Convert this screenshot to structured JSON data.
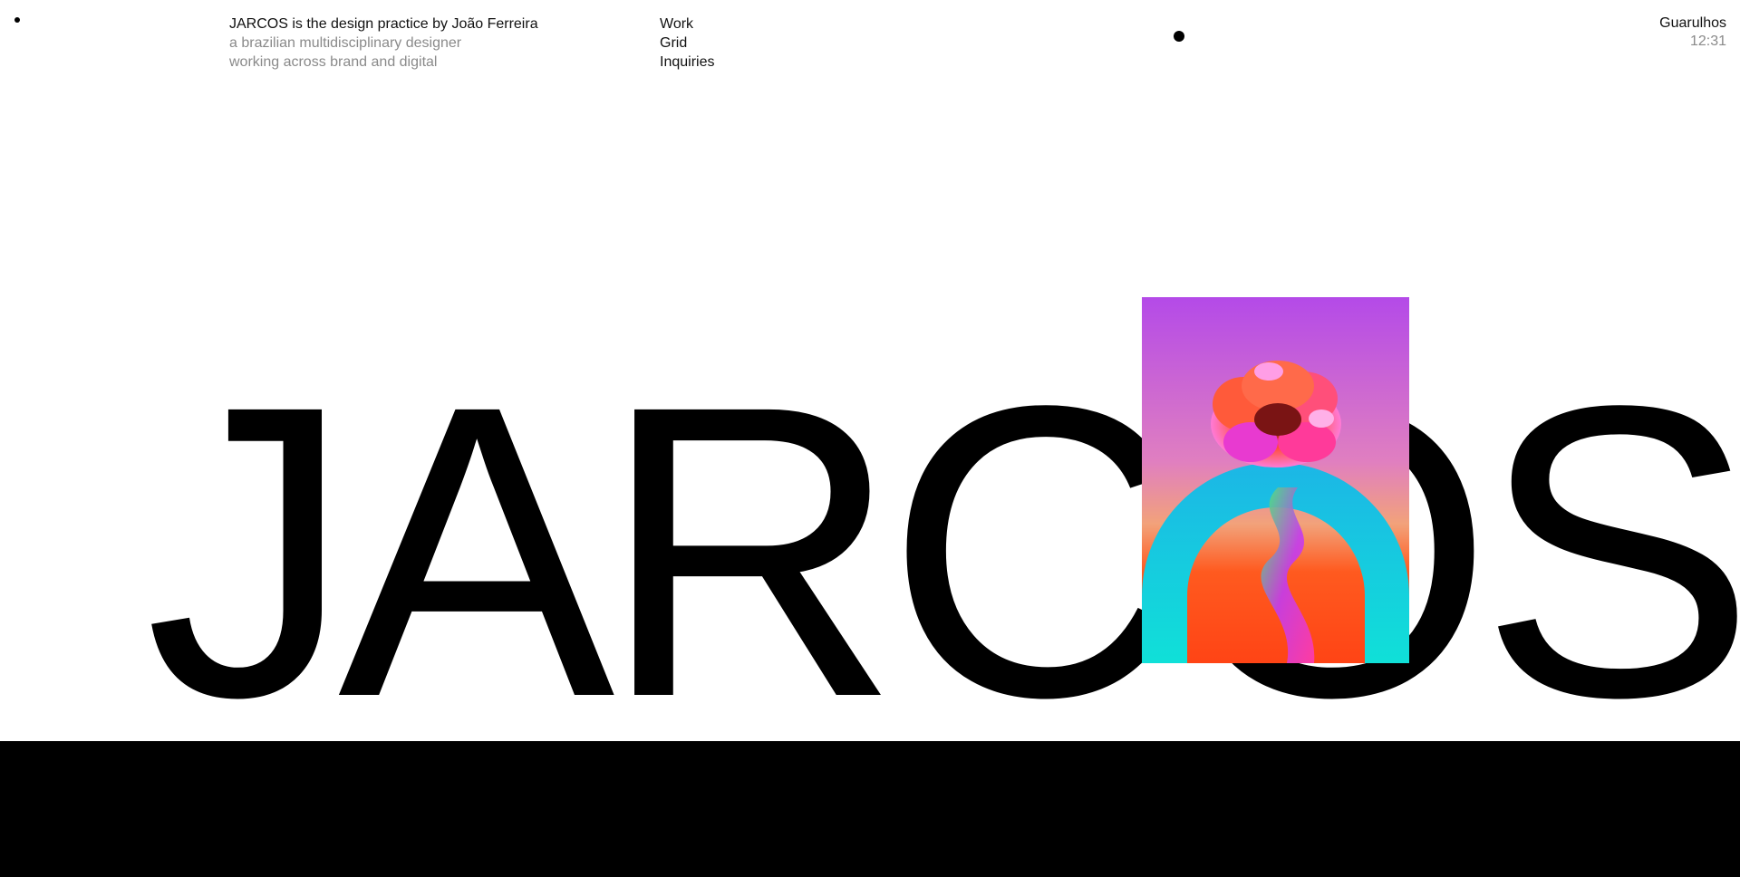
{
  "header": {
    "intro": {
      "line1": "JARCOS is the design practice by João Ferreira",
      "line2": "a brazilian multidisciplinary designer",
      "line3": "working across brand and digital"
    },
    "nav": [
      "Work",
      "Grid",
      "Inquiries"
    ],
    "location": {
      "city": "Guarulhos",
      "time": "12:31"
    }
  },
  "hero": {
    "wordmark": "JARCOS",
    "artwork_icon": "flower-artwork"
  },
  "colors": {
    "background": "#ffffff",
    "text": "#111111",
    "muted": "#8a8a8a",
    "band": "#000000",
    "art_top": "#b44ae8",
    "art_mid": "#e07fc0",
    "art_orange": "#ff5a1f",
    "art_cyan": "#15d6df"
  }
}
